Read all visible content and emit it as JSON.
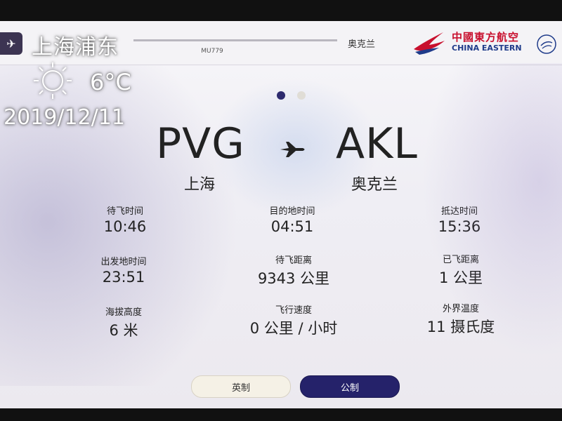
{
  "header": {
    "flight_number": "MU779",
    "destination_name": "奥克兰",
    "logo_cn": "中國東方航空",
    "logo_en": "CHINA EASTERN"
  },
  "overlay": {
    "city": "上海浦东",
    "temperature": "6°C",
    "date": "2019/12/11",
    "weather_icon": "sun-icon"
  },
  "route": {
    "origin_code": "PVG",
    "destination_code": "AKL",
    "origin_city": "上海",
    "destination_city": "奥克兰"
  },
  "pager": {
    "current_page": 1,
    "total_pages": 2
  },
  "stats": {
    "time_to_destination": {
      "label": "待飞时间",
      "value": "10:46"
    },
    "destination_time": {
      "label": "目的地时间",
      "value": "04:51"
    },
    "arrival_time": {
      "label": "抵达时间",
      "value": "15:36"
    },
    "departure_time": {
      "label": "出发地时间",
      "value": "23:51"
    },
    "distance_remaining": {
      "label": "待飞距离",
      "value": "9343 公里"
    },
    "distance_flown": {
      "label": "已飞距离",
      "value": "1 公里"
    },
    "altitude": {
      "label": "海拔高度",
      "value": "6 米"
    },
    "ground_speed": {
      "label": "飞行速度",
      "value": "0 公里 / 小时"
    },
    "outside_temperature": {
      "label": "外界温度",
      "value": "11 摄氏度"
    }
  },
  "units": {
    "imperial_label": "英制",
    "metric_label": "公制",
    "selected": "metric"
  },
  "colors": {
    "accent": "#25226a",
    "brand_red": "#c8102e",
    "brand_blue": "#1f3b8a"
  }
}
